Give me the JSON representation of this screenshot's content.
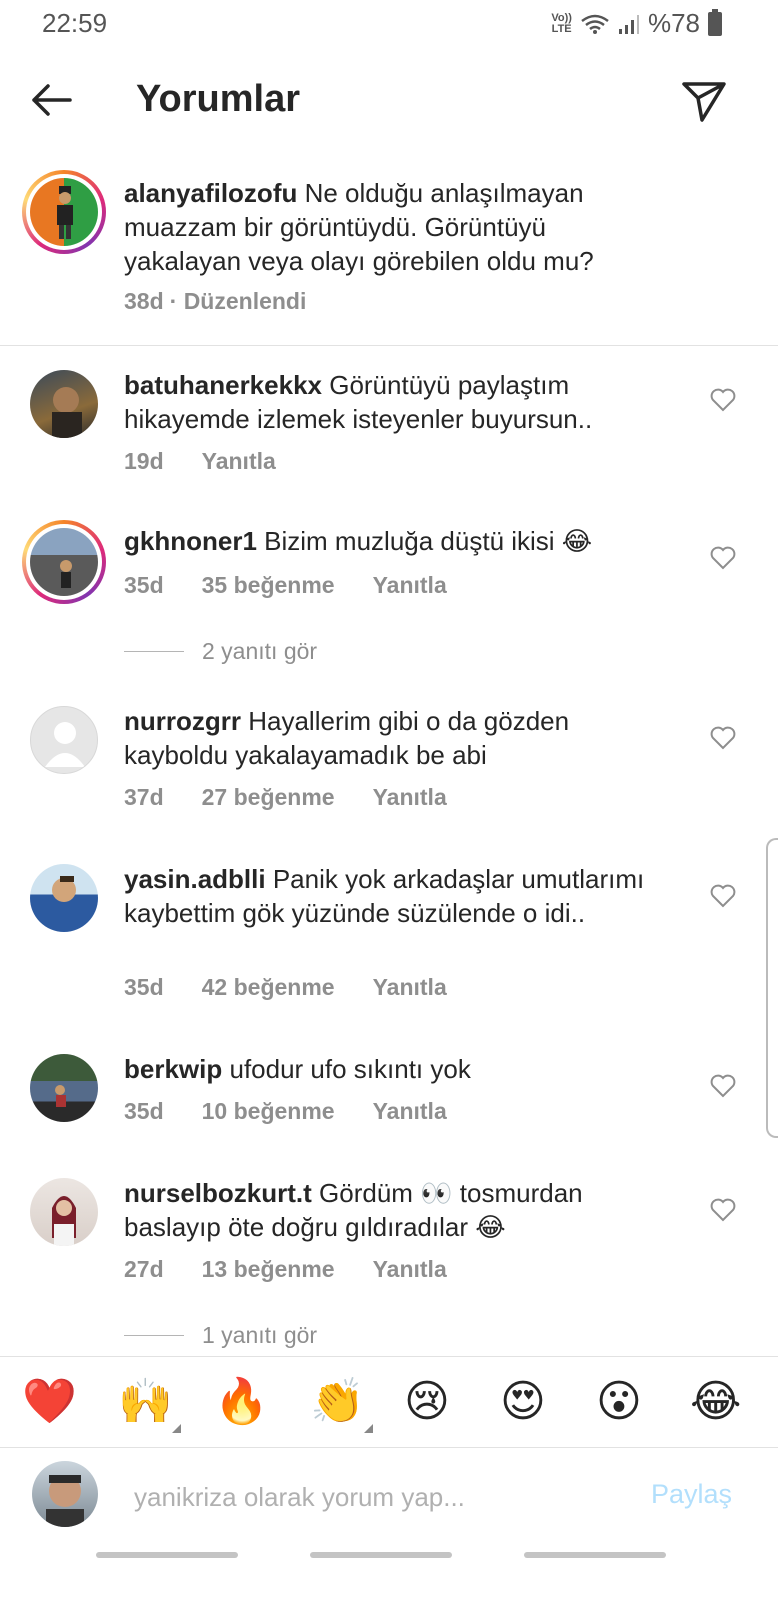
{
  "status": {
    "time": "22:59",
    "network": "Vo)) LTE",
    "battery": "%78"
  },
  "header": {
    "title": "Yorumlar",
    "back_icon": "arrow-left-icon",
    "send_icon": "paper-plane-icon"
  },
  "caption": {
    "username": "alanyafilozofu",
    "text": "Ne olduğu anlaşılmayan muazzam bir görüntüydü. Görüntüyü yakalayan veya olayı görebilen oldu mu?",
    "time": "38d",
    "edited": "· Düzenlendi"
  },
  "comments": [
    {
      "username": "batuhanerkekkx",
      "text": "Görüntüyü paylaştım hikayemde izlemek isteyenler buyursun..",
      "time": "19d",
      "likes": "",
      "reply": "Yanıtla"
    },
    {
      "username": "gkhnoner1",
      "text": "Bizim muzluğa düştü ikisi 😂",
      "time": "35d",
      "likes": "35 beğenme",
      "reply": "Yanıtla",
      "view_replies": "2 yanıtı gör"
    },
    {
      "username": "nurrozgrr",
      "text": "Hayallerim gibi o da gözden kayboldu yakalayamadık be abi",
      "time": "37d",
      "likes": "27 beğenme",
      "reply": "Yanıtla"
    },
    {
      "username": "yasin.adblli",
      "text": "Panik yok arkadaşlar umutlarımı kaybettim gök yüzünde süzülende o idi..",
      "time": "35d",
      "likes": "42 beğenme",
      "reply": "Yanıtla"
    },
    {
      "username": "berkwip",
      "text": "ufodur ufo sıkıntı yok",
      "time": "35d",
      "likes": "10 beğenme",
      "reply": "Yanıtla"
    },
    {
      "username": "nurselbozkurt.t",
      "text": "Gördüm 👀 tosmurdan baslayıp öte doğru gıldıradılar 😂",
      "time": "27d",
      "likes": "13 beğenme",
      "reply": "Yanıtla",
      "view_replies": "1 yanıtı gör"
    }
  ],
  "emoji_bar": [
    "❤️",
    "🙌",
    "🔥",
    "👏",
    "😢",
    "😍",
    "😮",
    "😂"
  ],
  "input": {
    "placeholder": "yanikriza olarak yorum yap...",
    "share_label": "Paylaş"
  },
  "colors": {
    "text": "#262626",
    "meta": "#8e8e8e",
    "share_disabled": "#b2dffc",
    "story_ring": "#dd2a7b"
  }
}
